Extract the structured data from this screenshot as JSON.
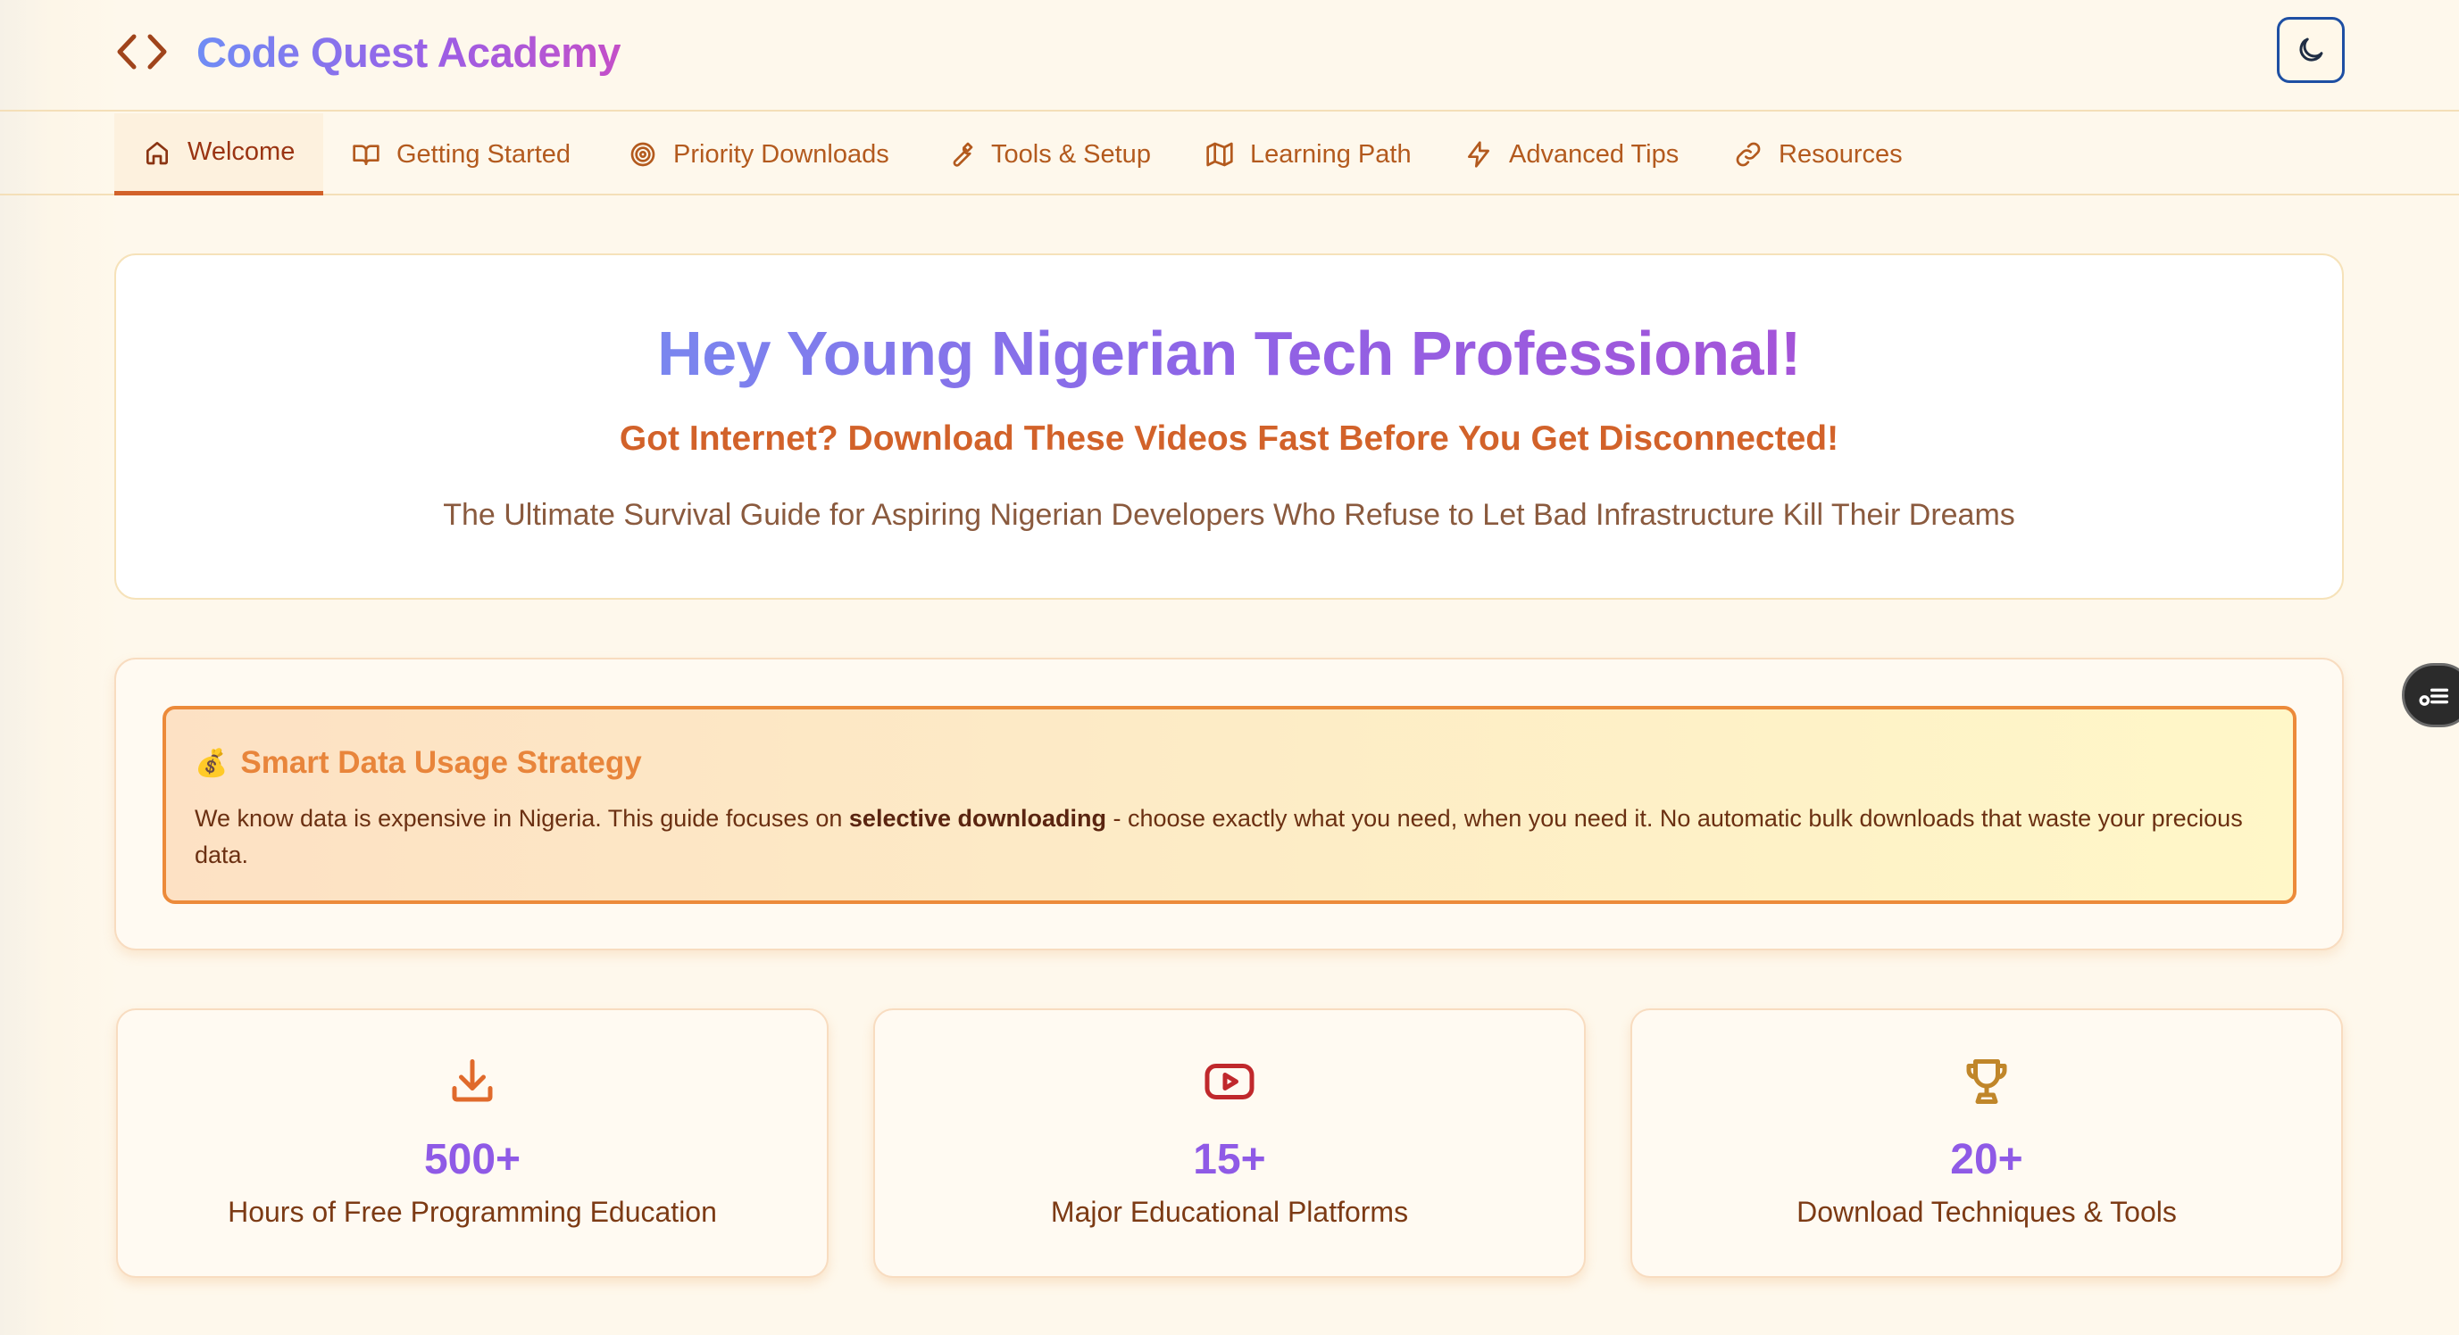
{
  "brand": {
    "title": "Code Quest Academy",
    "icon": "code-brackets-icon"
  },
  "theme_toggle": {
    "icon": "moon-icon"
  },
  "nav": {
    "tabs": [
      {
        "label": "Welcome",
        "icon": "home-icon",
        "active": true
      },
      {
        "label": "Getting Started",
        "icon": "book-icon",
        "active": false
      },
      {
        "label": "Priority Downloads",
        "icon": "target-icon",
        "active": false
      },
      {
        "label": "Tools & Setup",
        "icon": "wrench-icon",
        "active": false
      },
      {
        "label": "Learning Path",
        "icon": "map-icon",
        "active": false
      },
      {
        "label": "Advanced Tips",
        "icon": "lightning-icon",
        "active": false
      },
      {
        "label": "Resources",
        "icon": "link-icon",
        "active": false
      }
    ]
  },
  "hero": {
    "title": "Hey Young Nigerian Tech Professional!",
    "subtitle": "Got Internet? Download These Videos Fast Before You Get Disconnected!",
    "description": "The Ultimate Survival Guide for Aspiring Nigerian Developers Who Refuse to Let Bad Infrastructure Kill Their Dreams"
  },
  "strategy": {
    "emoji": "💰",
    "title": "Smart Data Usage Strategy",
    "text_before": "We know data is expensive in Nigeria. This guide focuses on ",
    "text_bold": "selective downloading",
    "text_after": " - choose exactly what you need, when you need it. No automatic bulk downloads that waste your precious data."
  },
  "stats": [
    {
      "icon": "download-icon",
      "value": "500+",
      "label": "Hours of Free Programming Education"
    },
    {
      "icon": "youtube-play-icon",
      "value": "15+",
      "label": "Major Educational Platforms"
    },
    {
      "icon": "trophy-icon",
      "value": "20+",
      "label": "Download Techniques & Tools"
    }
  ],
  "colors": {
    "background": "#fef8ec",
    "accent_orange": "#d2622a",
    "accent_purple": "#8f5ae6",
    "active_tab_border": "#d2622a",
    "toggle_border": "#1e4fa3"
  }
}
